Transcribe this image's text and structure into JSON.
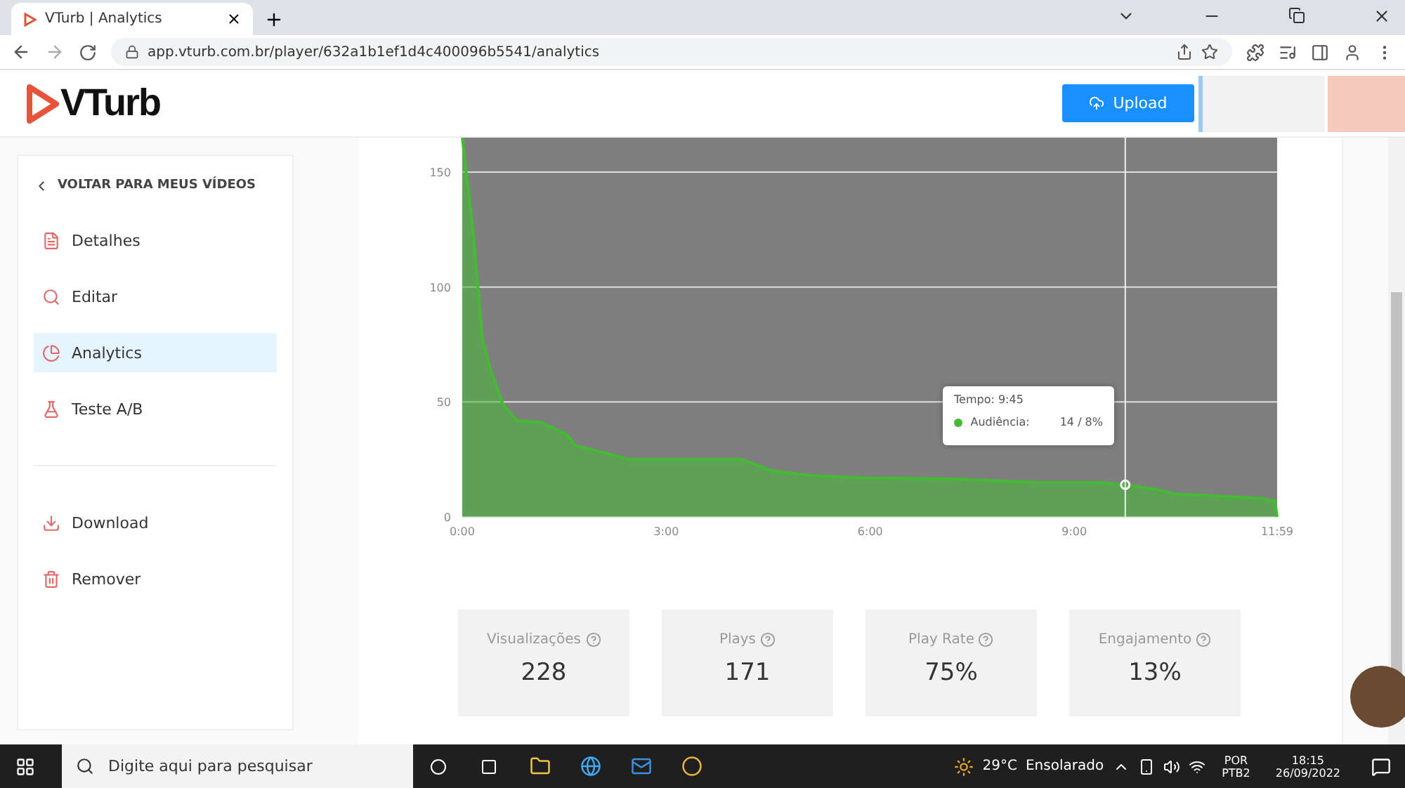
{
  "browser": {
    "tab_title": "VTurb | Analytics",
    "url": "app.vturb.com.br/player/632a1b1ef1d4c400096b5541/analytics"
  },
  "header": {
    "logo": "VTurb",
    "upload_button": "Upload"
  },
  "sidebar": {
    "back_link": "VOLTAR PARA MEUS VÍDEOS",
    "items": [
      {
        "label": "Detalhes",
        "selected": false
      },
      {
        "label": "Editar",
        "selected": false
      },
      {
        "label": "Analytics",
        "selected": true
      },
      {
        "label": "Teste A/B",
        "selected": false
      }
    ],
    "actions": [
      {
        "label": "Download"
      },
      {
        "label": "Remover"
      }
    ]
  },
  "retention_chart": {
    "chart_data": {
      "type": "area",
      "x": [
        0,
        9,
        18,
        25,
        36,
        48,
        70,
        92,
        100,
        125,
        147,
        247,
        274,
        308,
        352,
        435,
        507,
        562,
        585,
        612,
        628,
        672,
        706,
        717,
        719
      ],
      "series": [
        {
          "color": "#44bb33",
          "values": [
            165,
            127,
            77,
            64,
            49,
            42,
            41,
            36,
            31,
            28,
            25,
            25,
            20,
            18,
            17,
            16.5,
            15,
            15,
            14,
            12,
            10,
            9,
            8,
            7,
            0
          ]
        }
      ],
      "xlim": [
        0,
        719
      ],
      "ylim": [
        0,
        165
      ],
      "xticks": [
        {
          "value": 0,
          "label": "0:00"
        },
        {
          "value": 180,
          "label": "3:00"
        },
        {
          "value": 360,
          "label": "6:00"
        },
        {
          "value": 540,
          "label": "9:00"
        },
        {
          "value": 719,
          "label": "11:59"
        }
      ],
      "yticks": [
        0,
        50,
        100,
        150
      ],
      "grid": true,
      "ref_lines": [
        {
          "axis": "x",
          "value": 585
        }
      ]
    },
    "tooltip": {
      "title": "Tempo: 9:45",
      "label": "Audiência:",
      "value": "14 / 8%"
    }
  },
  "stats": [
    {
      "label": "Visualizações",
      "value": "228"
    },
    {
      "label": "Plays",
      "value": "171"
    },
    {
      "label": "Play Rate",
      "value": "75%"
    },
    {
      "label": "Engajamento",
      "value": "13%"
    }
  ],
  "taskbar": {
    "search_placeholder": "Digite aqui para pesquisar",
    "temperature": "29°C",
    "weather": "Ensolarado",
    "language": "POR",
    "layout": "PTB2",
    "time": "18:15",
    "date": "26/09/2022"
  }
}
